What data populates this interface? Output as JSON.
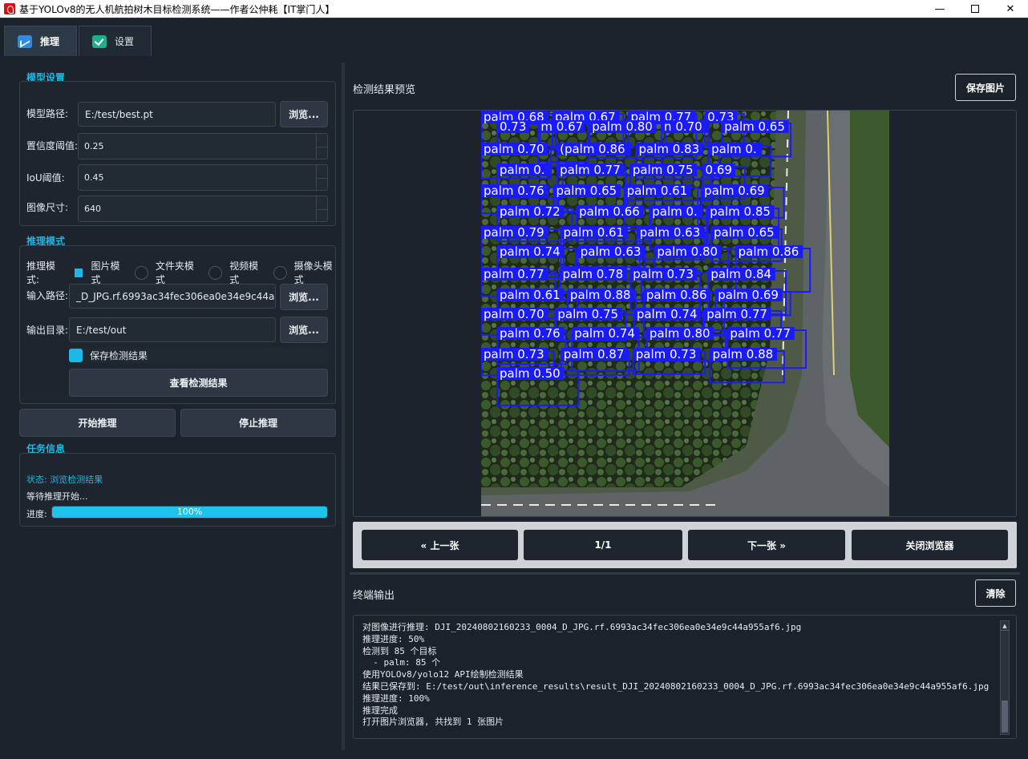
{
  "window": {
    "title": "基于YOLOv8的无人机航拍树木目标检测系统——作者公仲耗【IT掌门人】",
    "minimize": "—",
    "close": "✕"
  },
  "tabs": [
    {
      "label": "推理",
      "icon": "chart-icon",
      "active": true
    },
    {
      "label": "设置",
      "icon": "check-icon",
      "active": false
    }
  ],
  "model_settings": {
    "title": "模型设置",
    "model_path_label": "模型路径:",
    "model_path_value": "E:/test/best.pt",
    "browse_label": "浏览...",
    "confidence_label": "置信度阈值:",
    "confidence_value": "0.25",
    "iou_label": "IoU阈值:",
    "iou_value": "0.45",
    "imgsz_label": "图像尺寸:",
    "imgsz_value": "640"
  },
  "inference_mode": {
    "title": "推理模式",
    "mode_label": "推理模式:",
    "options": [
      "图片模式",
      "文件夹模式",
      "视频模式",
      "摄像头模式"
    ],
    "selected": "图片模式",
    "input_label": "输入路径:",
    "input_value": "_D_JPG.rf.6993ac34fec306ea0e34e9c44a955af6.jpg",
    "output_label": "输出目录:",
    "output_value": "E:/test/out",
    "browse_label": "浏览...",
    "save_results_label": "保存检测结果",
    "save_results_checked": true,
    "view_results_button": "查看检测结果"
  },
  "actions": {
    "start": "开始推理",
    "stop": "停止推理"
  },
  "task_info": {
    "title": "任务信息",
    "status": "状态: 浏览检测结果",
    "waiting": "等待推理开始...",
    "progress_label": "进度:",
    "progress_value": 100,
    "progress_text": "100%"
  },
  "preview": {
    "title": "检测结果预览",
    "save_button": "保存图片",
    "prev_button": "« 上一张",
    "page_indicator": "1/1",
    "next_button": "下一张 »",
    "close_button": "关闭浏览器",
    "detection_labels": [
      "palm 0.68",
      "palm 0.67",
      "palm 0.77",
      "0.73",
      "0.73",
      "m 0.67",
      "palm 0.80",
      "n 0.70",
      "palm 0.65",
      "palm 0.70",
      "(palm 0.86",
      "palm 0.83",
      "palm 0.",
      "palm 0.",
      "palm 0.77",
      "palm 0.75",
      "0.69",
      "palm 0.76",
      "palm 0.65",
      "palm 0.61",
      "palm 0.69",
      "palm 0.72",
      "palm 0.66",
      "palm 0.",
      "palm 0.85",
      "palm 0.79",
      "palm 0.61",
      "palm 0.63",
      "palm 0.65",
      "palm 0.74",
      "palm 0.63",
      "palm 0.80",
      "palm 0.86",
      "palm 0.77",
      "palm 0.78",
      "palm 0.73",
      "palm 0.84",
      "palm 0.61",
      "palm 0.88",
      "palm 0.86",
      "palm 0.69",
      "palm 0.70",
      "palm 0.75",
      "palm 0.74",
      "palm 0.77",
      "palm 0.76",
      "palm 0.74",
      "palm 0.80",
      "palm 0.77",
      "palm 0.73",
      "palm 0.87",
      "palm 0.73",
      "palm 0.88",
      "palm 0.50"
    ]
  },
  "terminal": {
    "title": "终端输出",
    "clear_button": "清除",
    "lines": [
      "对图像进行推理: DJI_20240802160233_0004_D_JPG.rf.6993ac34fec306ea0e34e9c44a955af6.jpg",
      "推理进度: 50%",
      "检测到 85 个目标",
      "  - palm: 85 个",
      "使用YOLOv8/yolo12 API绘制检测结果",
      "结果已保存到: E:/test/out\\inference_results\\result_DJI_20240802160233_0004_D_JPG.rf.6993ac34fec306ea0e34e9c44a955af6.jpg",
      "推理进度: 100%",
      "推理完成",
      "打开图片浏览器, 共找到 1 张图片"
    ]
  },
  "colors": {
    "accent": "#1eb8e6",
    "detection_box": "#1a1aff",
    "background": "#1c232c"
  }
}
